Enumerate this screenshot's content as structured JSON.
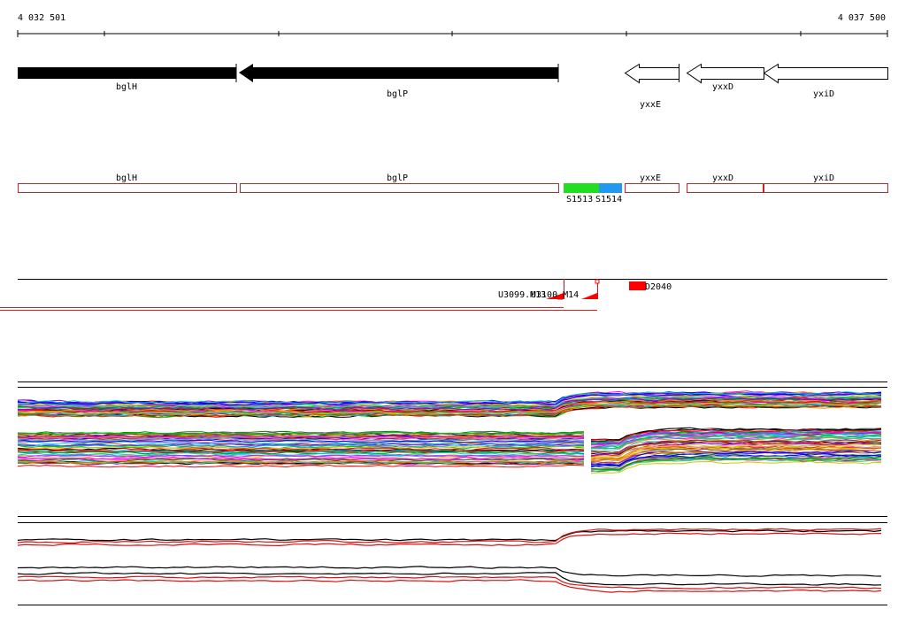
{
  "ruler": {
    "start_label": "4 032 501",
    "end_label": "4 037 500"
  },
  "genes": [
    {
      "name": "bglH"
    },
    {
      "name": "bglP"
    },
    {
      "name": "yxxE"
    },
    {
      "name": "yxxD"
    },
    {
      "name": "yxiD"
    }
  ],
  "segments": [
    {
      "name": "S1513",
      "color": "#22dd22"
    },
    {
      "name": "S1514",
      "color": "#2299ee"
    }
  ],
  "sites": [
    "U3099.M13",
    "U3100_M14",
    "D2040"
  ],
  "colors": {
    "gene_arrow": "#000000",
    "annotation_box": "#cc2222",
    "site_marker": "#ff0000",
    "profile_highlight": "#dd1111"
  }
}
